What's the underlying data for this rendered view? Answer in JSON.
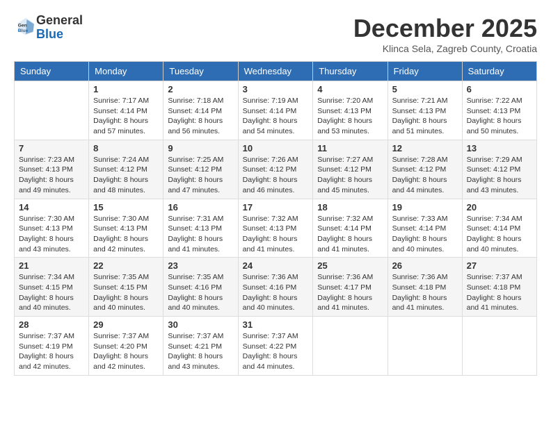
{
  "header": {
    "logo_line1": "General",
    "logo_line2": "Blue",
    "month_year": "December 2025",
    "location": "Klinca Sela, Zagreb County, Croatia"
  },
  "days_of_week": [
    "Sunday",
    "Monday",
    "Tuesday",
    "Wednesday",
    "Thursday",
    "Friday",
    "Saturday"
  ],
  "weeks": [
    [
      {
        "day": "",
        "info": ""
      },
      {
        "day": "1",
        "info": "Sunrise: 7:17 AM\nSunset: 4:14 PM\nDaylight: 8 hours\nand 57 minutes."
      },
      {
        "day": "2",
        "info": "Sunrise: 7:18 AM\nSunset: 4:14 PM\nDaylight: 8 hours\nand 56 minutes."
      },
      {
        "day": "3",
        "info": "Sunrise: 7:19 AM\nSunset: 4:14 PM\nDaylight: 8 hours\nand 54 minutes."
      },
      {
        "day": "4",
        "info": "Sunrise: 7:20 AM\nSunset: 4:13 PM\nDaylight: 8 hours\nand 53 minutes."
      },
      {
        "day": "5",
        "info": "Sunrise: 7:21 AM\nSunset: 4:13 PM\nDaylight: 8 hours\nand 51 minutes."
      },
      {
        "day": "6",
        "info": "Sunrise: 7:22 AM\nSunset: 4:13 PM\nDaylight: 8 hours\nand 50 minutes."
      }
    ],
    [
      {
        "day": "7",
        "info": "Sunrise: 7:23 AM\nSunset: 4:13 PM\nDaylight: 8 hours\nand 49 minutes."
      },
      {
        "day": "8",
        "info": "Sunrise: 7:24 AM\nSunset: 4:12 PM\nDaylight: 8 hours\nand 48 minutes."
      },
      {
        "day": "9",
        "info": "Sunrise: 7:25 AM\nSunset: 4:12 PM\nDaylight: 8 hours\nand 47 minutes."
      },
      {
        "day": "10",
        "info": "Sunrise: 7:26 AM\nSunset: 4:12 PM\nDaylight: 8 hours\nand 46 minutes."
      },
      {
        "day": "11",
        "info": "Sunrise: 7:27 AM\nSunset: 4:12 PM\nDaylight: 8 hours\nand 45 minutes."
      },
      {
        "day": "12",
        "info": "Sunrise: 7:28 AM\nSunset: 4:12 PM\nDaylight: 8 hours\nand 44 minutes."
      },
      {
        "day": "13",
        "info": "Sunrise: 7:29 AM\nSunset: 4:12 PM\nDaylight: 8 hours\nand 43 minutes."
      }
    ],
    [
      {
        "day": "14",
        "info": "Sunrise: 7:30 AM\nSunset: 4:13 PM\nDaylight: 8 hours\nand 43 minutes."
      },
      {
        "day": "15",
        "info": "Sunrise: 7:30 AM\nSunset: 4:13 PM\nDaylight: 8 hours\nand 42 minutes."
      },
      {
        "day": "16",
        "info": "Sunrise: 7:31 AM\nSunset: 4:13 PM\nDaylight: 8 hours\nand 41 minutes."
      },
      {
        "day": "17",
        "info": "Sunrise: 7:32 AM\nSunset: 4:13 PM\nDaylight: 8 hours\nand 41 minutes."
      },
      {
        "day": "18",
        "info": "Sunrise: 7:32 AM\nSunset: 4:14 PM\nDaylight: 8 hours\nand 41 minutes."
      },
      {
        "day": "19",
        "info": "Sunrise: 7:33 AM\nSunset: 4:14 PM\nDaylight: 8 hours\nand 40 minutes."
      },
      {
        "day": "20",
        "info": "Sunrise: 7:34 AM\nSunset: 4:14 PM\nDaylight: 8 hours\nand 40 minutes."
      }
    ],
    [
      {
        "day": "21",
        "info": "Sunrise: 7:34 AM\nSunset: 4:15 PM\nDaylight: 8 hours\nand 40 minutes."
      },
      {
        "day": "22",
        "info": "Sunrise: 7:35 AM\nSunset: 4:15 PM\nDaylight: 8 hours\nand 40 minutes."
      },
      {
        "day": "23",
        "info": "Sunrise: 7:35 AM\nSunset: 4:16 PM\nDaylight: 8 hours\nand 40 minutes."
      },
      {
        "day": "24",
        "info": "Sunrise: 7:36 AM\nSunset: 4:16 PM\nDaylight: 8 hours\nand 40 minutes."
      },
      {
        "day": "25",
        "info": "Sunrise: 7:36 AM\nSunset: 4:17 PM\nDaylight: 8 hours\nand 41 minutes."
      },
      {
        "day": "26",
        "info": "Sunrise: 7:36 AM\nSunset: 4:18 PM\nDaylight: 8 hours\nand 41 minutes."
      },
      {
        "day": "27",
        "info": "Sunrise: 7:37 AM\nSunset: 4:18 PM\nDaylight: 8 hours\nand 41 minutes."
      }
    ],
    [
      {
        "day": "28",
        "info": "Sunrise: 7:37 AM\nSunset: 4:19 PM\nDaylight: 8 hours\nand 42 minutes."
      },
      {
        "day": "29",
        "info": "Sunrise: 7:37 AM\nSunset: 4:20 PM\nDaylight: 8 hours\nand 42 minutes."
      },
      {
        "day": "30",
        "info": "Sunrise: 7:37 AM\nSunset: 4:21 PM\nDaylight: 8 hours\nand 43 minutes."
      },
      {
        "day": "31",
        "info": "Sunrise: 7:37 AM\nSunset: 4:22 PM\nDaylight: 8 hours\nand 44 minutes."
      },
      {
        "day": "",
        "info": ""
      },
      {
        "day": "",
        "info": ""
      },
      {
        "day": "",
        "info": ""
      }
    ]
  ]
}
